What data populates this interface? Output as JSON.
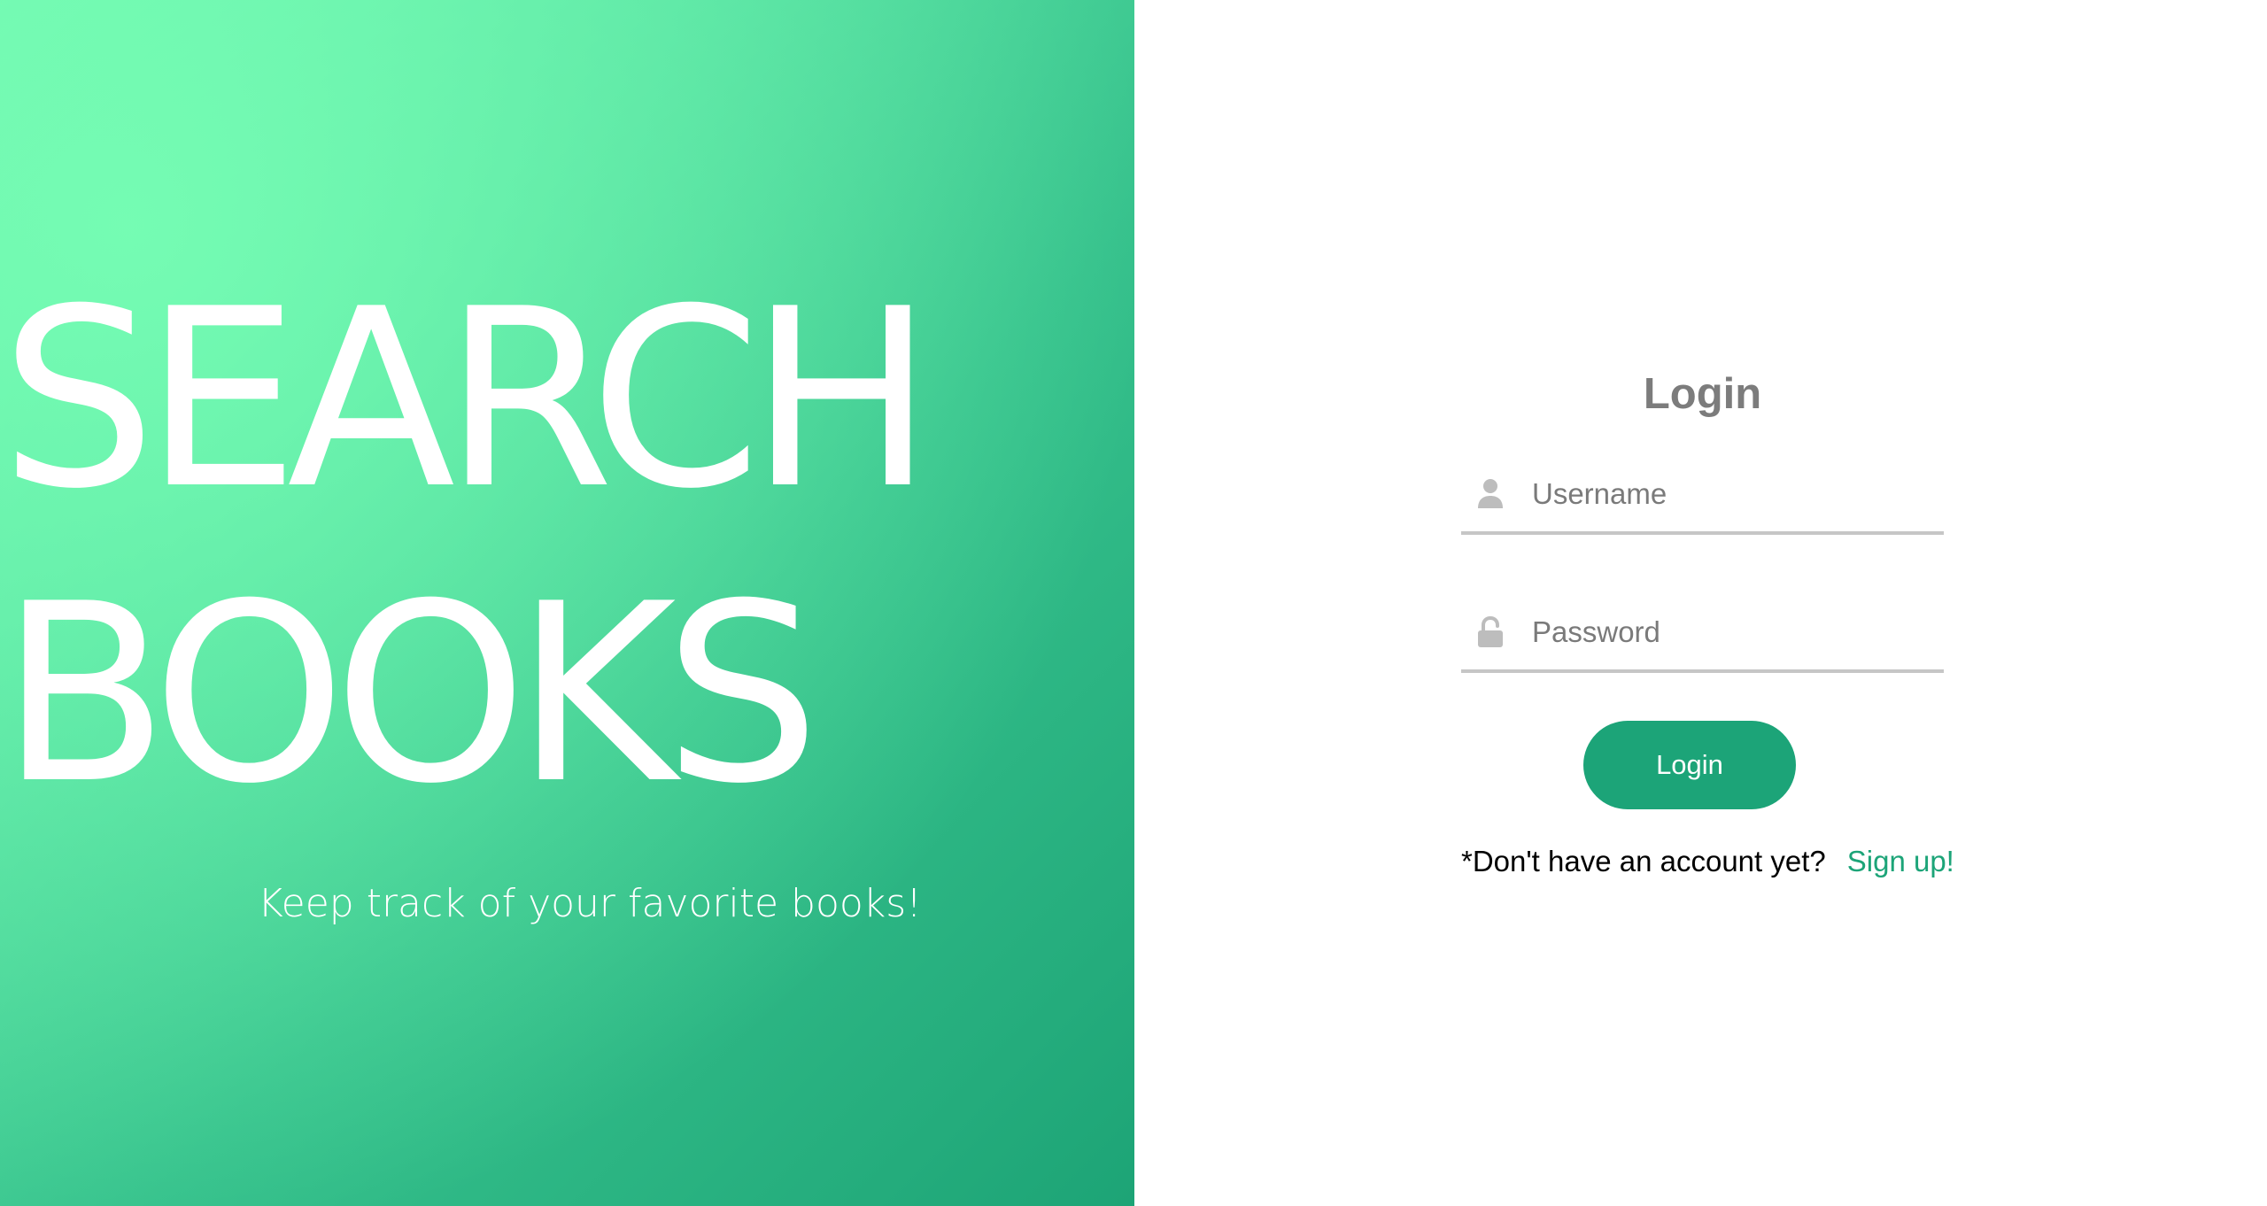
{
  "hero": {
    "title_line1": "SEARCH",
    "title_line2": "BOOKS",
    "tagline": "Keep track of your favorite books!",
    "gradient_light": "#6ff5b1",
    "gradient_dark": "#1da476"
  },
  "login": {
    "heading": "Login",
    "username_icon": "user-icon",
    "username_placeholder": "Username",
    "password_icon": "unlock-icon",
    "password_placeholder": "Password",
    "button_label": "Login",
    "signup_prompt": "*Don't have an account yet?",
    "signup_link": "Sign up!",
    "accent_color": "#1ca478"
  }
}
